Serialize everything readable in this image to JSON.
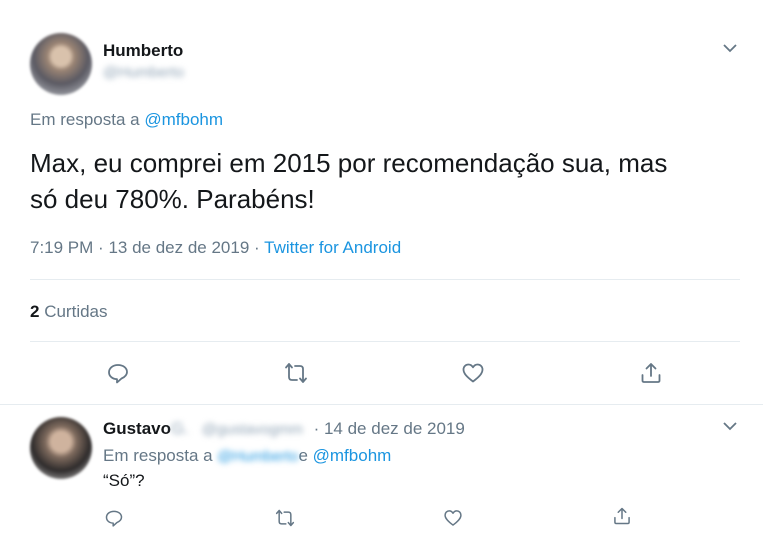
{
  "main_tweet": {
    "author_name": "Humberto",
    "author_handle": "@Humberto",
    "reply_prefix": "Em resposta a",
    "reply_to": "@mfbohm",
    "text_line1": "Max, eu comprei em 2015 por recomendação sua, mas",
    "text_line2": "só deu 780%. Parabéns!",
    "time": "7:19 PM",
    "separator": "·",
    "date": "13 de dez de 2019",
    "source": "Twitter for Android",
    "likes_count": "2",
    "likes_label": "Curtidas"
  },
  "reply_tweet": {
    "author_name": "Gustavo",
    "author_name_suffix": "G.",
    "author_handle": "@gustavogmm",
    "separator": "·",
    "date": "14 de dez de 2019",
    "reply_prefix": "Em resposta a",
    "reply_to_blurred": "@Humberto",
    "reply_conj": "e",
    "reply_to": "@mfbohm",
    "text": "“Só”?"
  },
  "icons": {
    "reply": "reply-icon",
    "retweet": "retweet-icon",
    "like": "heart-icon",
    "share": "share-icon",
    "menu": "chevron-down-icon"
  },
  "colors": {
    "link": "#1b95e0",
    "secondary_text": "#657786",
    "divider": "#e6ecf0"
  }
}
